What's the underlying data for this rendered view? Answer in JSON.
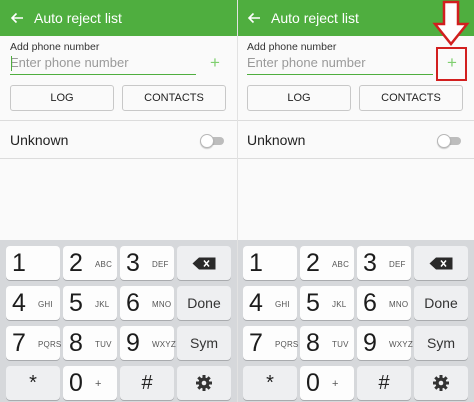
{
  "screens": [
    {
      "appbar": {
        "title": "Auto reject list"
      },
      "input": {
        "label": "Add phone number",
        "placeholder": "Enter phone number",
        "add_symbol": "+"
      },
      "buttons": {
        "log": "LOG",
        "contacts": "CONTACTS"
      },
      "unknown": {
        "label": "Unknown",
        "enabled": false
      }
    },
    {
      "appbar": {
        "title": "Auto reject list"
      },
      "input": {
        "label": "Add phone number",
        "placeholder": "Enter phone number",
        "add_symbol": "+"
      },
      "buttons": {
        "log": "LOG",
        "contacts": "CONTACTS"
      },
      "unknown": {
        "label": "Unknown",
        "enabled": false
      }
    }
  ],
  "keyboard": {
    "keys": [
      {
        "digit": "1",
        "letters": ""
      },
      {
        "digit": "2",
        "letters": "ABC"
      },
      {
        "digit": "3",
        "letters": "DEF"
      },
      {
        "digit": "4",
        "letters": "GHI"
      },
      {
        "digit": "5",
        "letters": "JKL"
      },
      {
        "digit": "6",
        "letters": "MNO"
      },
      {
        "digit": "7",
        "letters": "PQRS"
      },
      {
        "digit": "8",
        "letters": "TUV"
      },
      {
        "digit": "9",
        "letters": "WXYZ"
      },
      {
        "digit": "0",
        "letters": "+"
      }
    ],
    "done_label": "Done",
    "sym_label": "Sym",
    "star": "*",
    "hash": "#"
  },
  "icons": {
    "back": "back-arrow-icon",
    "backspace": "backspace-icon",
    "settings": "gear-icon",
    "annotation": "red-down-arrow-icon"
  },
  "colors": {
    "appbar": "#4fae3f",
    "accent": "#4fae3f",
    "add_icon": "#7fcf6f",
    "annotation": "#d21f1f",
    "keyboard_bg": "#d6d8db"
  }
}
